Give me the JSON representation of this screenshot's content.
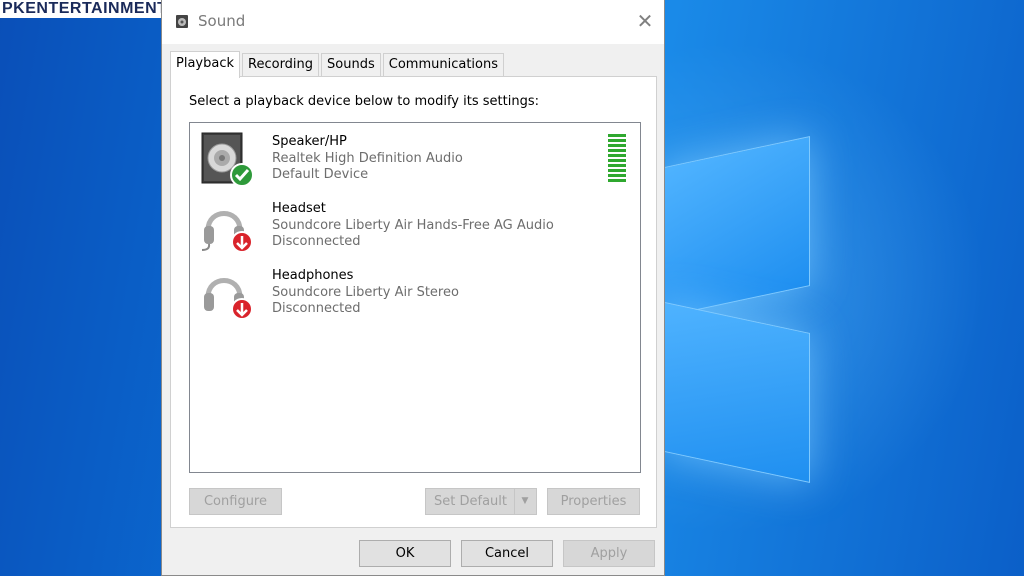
{
  "watermark": "PKENTERTAINMENT.ID",
  "window": {
    "title": "Sound",
    "close_glyph": "✕"
  },
  "tabs": [
    {
      "label": "Playback",
      "active": true
    },
    {
      "label": "Recording",
      "active": false
    },
    {
      "label": "Sounds",
      "active": false
    },
    {
      "label": "Communications",
      "active": false
    }
  ],
  "instruction": "Select a playback device below to modify its settings:",
  "devices": [
    {
      "name": "Speaker/HP",
      "description": "Realtek High Definition Audio",
      "status": "Default Device",
      "icon": "speaker-icon",
      "badge": "default-check-icon"
    },
    {
      "name": "Headset",
      "description": "Soundcore Liberty Air Hands-Free AG Audio",
      "status": "Disconnected",
      "icon": "headset-icon",
      "badge": "disconnected-arrow-icon"
    },
    {
      "name": "Headphones",
      "description": "Soundcore Liberty Air Stereo",
      "status": "Disconnected",
      "icon": "headphones-icon",
      "badge": "disconnected-arrow-icon"
    }
  ],
  "buttons": {
    "configure": "Configure",
    "set_default": "Set Default",
    "properties": "Properties",
    "ok": "OK",
    "cancel": "Cancel",
    "apply": "Apply"
  },
  "colors": {
    "default_badge": "#2e9a3a",
    "disconnected_badge": "#d9232b",
    "level_meter": "#2fa82f"
  }
}
